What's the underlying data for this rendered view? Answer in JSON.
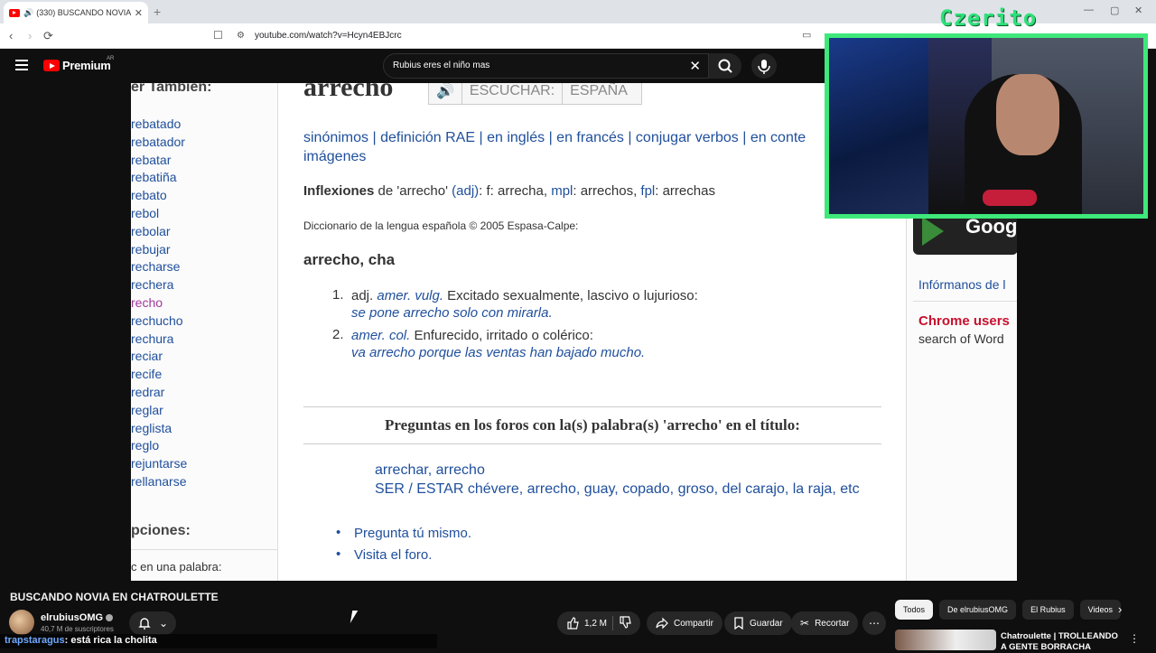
{
  "browser": {
    "tab_title": "(330) BUSCANDO NOVIA EN",
    "new_tab": "+",
    "url": "youtube.com/watch?v=Hcyn4EBJcrc"
  },
  "youtube": {
    "brand": "Premium",
    "country": "AR",
    "search_query": "Rubius eres el niño mas"
  },
  "page": {
    "sidebar_header": "er También:",
    "sidebar_words": [
      "rebatado",
      "rebatador",
      "rebatar",
      "rebatiña",
      "rebato",
      "rebol",
      "rebolar",
      "rebujar",
      "recharse",
      "rechera",
      "recho",
      "rechucho",
      "rechura",
      "reciar",
      "recife",
      "redrar",
      "reglar",
      "reglista",
      "reglo",
      "rejuntarse",
      "rellanarse"
    ],
    "sidebar_header2": "pciones:",
    "sidebar_option": "c en una palabra:",
    "word": "arrecho",
    "listen_label": "ESCUCHAR:",
    "listen_region": "ESPAÑA",
    "links_line1": "sinónimos | definición RAE | en inglés | en francés | conjugar verbos | en conte",
    "links_line2": "imágenes",
    "inflections_label": "Inflexiones",
    "inflections_rest1": " de 'arrecho' ",
    "inflections_adj": "(adj)",
    "inflections_rest2": ": f: arrecha, ",
    "inflections_mpl": "mpl",
    "inflections_rest3": ": arrechos, ",
    "inflections_fpl": "fpl",
    "inflections_rest4": ": arrechas",
    "dict_source": "Diccionario de la lengua española © 2005 Espasa-Calpe:",
    "headword": "arrecho, cha",
    "def1_num": "1.",
    "def1_pre": "adj. ",
    "def1_tag": "amer. vulg.",
    "def1_text": " Excitado sexualmente, lascivo o lujurioso:",
    "def1_example": "se pone arrecho solo con mirarla.",
    "def2_num": "2.",
    "def2_tag": "amer. col.",
    "def2_text": " Enfurecido, irritado o colérico:",
    "def2_example": "va arrecho porque las ventas han bajado mucho.",
    "forum_title": "Preguntas en los foros con la(s) palabra(s) 'arrecho' en el título:",
    "forum_link1": "arrechar, arrecho",
    "forum_link2": "SER / ESTAR chévere, arrecho, guay, copado, groso, del carajo, la raja, etc",
    "bullet1": "Pregunta tú mismo.",
    "bullet2": "Visita el foro.",
    "right_inform": "Infórmanos de l",
    "right_chrome": "Chrome users",
    "right_search": "search of Word",
    "gplay_text": "Goog"
  },
  "cam": {
    "streamer_name": "Czerito"
  },
  "video": {
    "title": "BUSCANDO NOVIA EN CHATROULETTE",
    "channel": "elrubiusOMG",
    "subscribers": "40,7 M de suscriptores",
    "likes": "1,2 M",
    "share": "Compartir",
    "save": "Guardar",
    "clip": "Recortar"
  },
  "chat": {
    "user": "trapstaragus",
    "message": ": está rica la cholita"
  },
  "chips": [
    "Todos",
    "De elrubiusOMG",
    "El Rubius",
    "Videos"
  ],
  "recommended": {
    "title": "Chatroulette | TROLLEANDO A GENTE BORRACHA"
  }
}
